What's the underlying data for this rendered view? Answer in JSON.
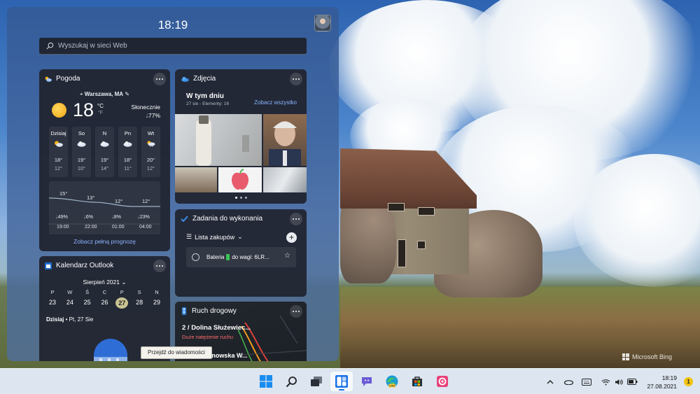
{
  "desktop": {
    "watermark": "Microsoft Bing"
  },
  "widgets": {
    "time": "18:19",
    "search": {
      "placeholder": "Wyszukaj w sieci Web"
    },
    "weather": {
      "title": "Pogoda",
      "location": "Warszawa, MA",
      "temperature": "18",
      "unit_c": "°C",
      "unit_f": "°F",
      "condition": "Słonecznie",
      "humidity": "77%",
      "days": [
        {
          "name": "Dzisiaj",
          "icon": "partly-sunny-icon",
          "high": "18°",
          "low": "12°"
        },
        {
          "name": "So",
          "icon": "cloudy-icon",
          "high": "19°",
          "low": "10°"
        },
        {
          "name": "N",
          "icon": "cloudy-icon",
          "high": "19°",
          "low": "14°"
        },
        {
          "name": "Pn",
          "icon": "cloudy-icon",
          "high": "18°",
          "low": "11°"
        },
        {
          "name": "Wt",
          "icon": "rain-sun-icon",
          "high": "20°",
          "low": "12°"
        }
      ],
      "hourly": [
        {
          "temp": "15°",
          "precip": "49%",
          "hour": "19:00"
        },
        {
          "temp": "13°",
          "precip": "6%",
          "hour": "22:00"
        },
        {
          "temp": "12°",
          "precip": "8%",
          "hour": "01:00"
        },
        {
          "temp": "12°",
          "precip": "23%",
          "hour": "04:00"
        }
      ],
      "forecast_link": "Zobacz pełną prognozę"
    },
    "photos": {
      "title": "Zdjęcia",
      "heading": "W tym dniu",
      "subtitle": "27 sie - Elementy: 16",
      "see_all": "Zobacz wszystko"
    },
    "tasks": {
      "title": "Zadania do wykonania",
      "list_name": "Lista zakupów",
      "items": [
        {
          "text_before": "Bateria",
          "text_after": "do wagi: 6LR..."
        }
      ]
    },
    "calendar": {
      "title": "Kalendarz Outlook",
      "month": "Sierpień 2021",
      "weekdays": [
        "P",
        "W",
        "Ś",
        "C",
        "P",
        "S",
        "N"
      ],
      "days": [
        "23",
        "24",
        "25",
        "26",
        "27",
        "28",
        "29"
      ],
      "today_label": "Dzisiaj",
      "today_date": "Pt, 27 Sie"
    },
    "traffic": {
      "title": "Ruch drogowy",
      "route": "2 / Dolina Służewiec...",
      "status": "Duże natężenie ruchu",
      "street": "Aleja Wilanowska W..."
    },
    "tooltip": "Przejdź do wiadomości"
  },
  "taskbar": {
    "apps": [
      "windows-start-icon",
      "search-icon",
      "task-view-icon",
      "widgets-icon",
      "teams-chat-icon",
      "edge-canary-icon",
      "microsoft-store-icon",
      "snipping-tool-icon"
    ],
    "time": "18:19",
    "date": "27.08.2021",
    "notification_count": "1"
  },
  "colors": {
    "accent": "#1a73e8",
    "link": "#8ab4ff",
    "alert": "#ff6b6b"
  }
}
